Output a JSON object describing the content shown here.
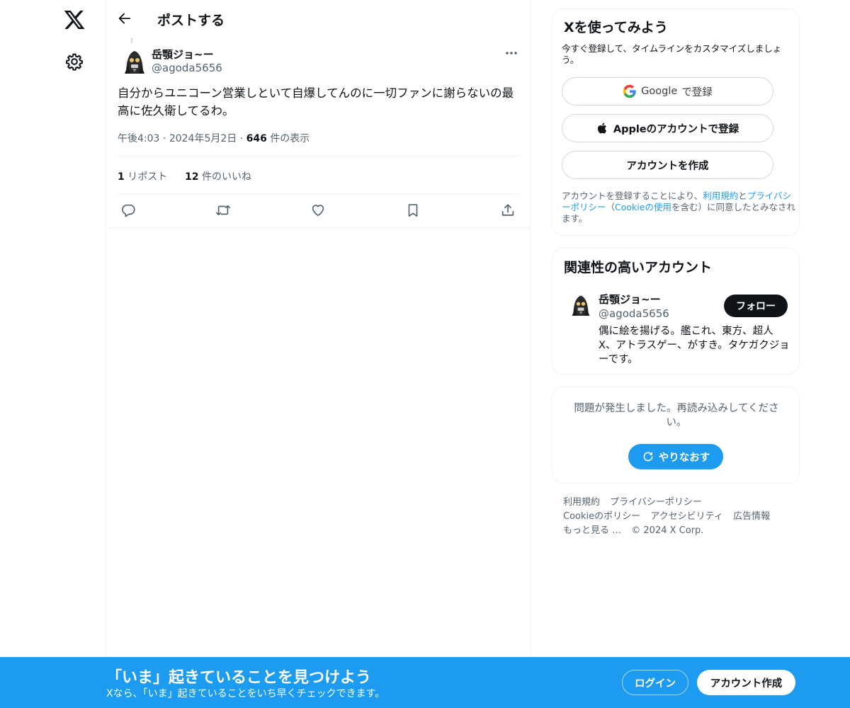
{
  "nav": {
    "logo_icon": "x-logo-icon",
    "settings_icon": "gear-icon"
  },
  "header": {
    "title": "ポストする",
    "back_icon": "arrow-left-icon"
  },
  "post": {
    "author_name": "岳顎ジョ~ー",
    "author_handle": "@agoda5656",
    "text": "自分からユニコーン営業しといて自爆してんのに一切ファンに謝らないの最高に佐久衛してるわ。",
    "time": "午後4:03",
    "date": "2024年5月2日",
    "views_count": "646",
    "views_label": "件の表示",
    "reposts_count": "1",
    "reposts_label": "リポスト",
    "likes_count": "12",
    "likes_label": "件のいいね",
    "actions": [
      "reply-icon",
      "repost-icon",
      "like-icon",
      "bookmark-icon",
      "share-icon"
    ]
  },
  "signup": {
    "title": "Xを使ってみよう",
    "subtitle": "今すぐ登録して、タイムラインをカスタマイズしましょう。",
    "google_label": "Google",
    "google_suffix": "で登録",
    "apple_label": "Appleのアカウントで登録",
    "create_label": "アカウントを作成",
    "terms_pre": "アカウントを登録することにより、",
    "terms_link1": "利用規約",
    "terms_and": "と",
    "terms_link2": "プライバシーポリシー",
    "terms_paren_open": "（",
    "terms_link3": "Cookieの使用",
    "terms_post": "を含む）に同意したとみなされます。"
  },
  "related": {
    "title": "関連性の高いアカウント",
    "name": "岳顎ジョ~ー",
    "handle": "@agoda5656",
    "follow_label": "フォロー",
    "bio": "偶に絵を揚げる。艦これ、東方、超人X、アトラスゲー、がすき。タケガクジョーです。"
  },
  "error": {
    "message": "問題が発生しました。再読み込みしてください。",
    "retry_label": "やりなおす"
  },
  "footer": {
    "links": [
      "利用規約",
      "プライバシーポリシー",
      "Cookieのポリシー",
      "アクセシビリティ",
      "広告情報",
      "もっと見る …",
      "© 2024 X Corp."
    ]
  },
  "bottom": {
    "title": "「いま」起きていることを見つけよう",
    "subtitle": "Xなら、「いま」起きていることをいち早くチェックできます。",
    "login_label": "ログイン",
    "signup_label": "アカウント作成"
  },
  "colors": {
    "accent": "#1d9bf0",
    "text": "#0f1419",
    "muted": "#536471",
    "border": "#eff3f4"
  }
}
